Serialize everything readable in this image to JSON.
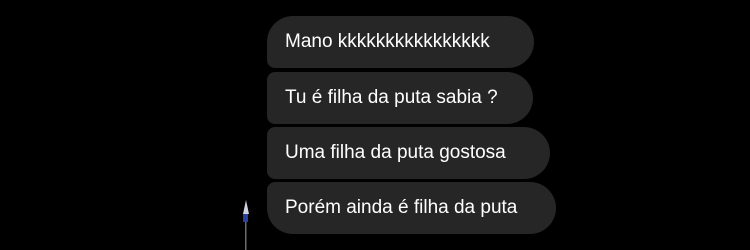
{
  "chat": {
    "messages": [
      {
        "text": "Mano kkkkkkkkkkkkkkkk"
      },
      {
        "text": "Tu é filha da puta sabia ?"
      },
      {
        "text": "Uma filha da puta gostosa"
      },
      {
        "text": "Porém ainda é filha da puta"
      }
    ],
    "colors": {
      "background": "#000000",
      "bubble": "#262626",
      "text": "#ffffff"
    }
  }
}
